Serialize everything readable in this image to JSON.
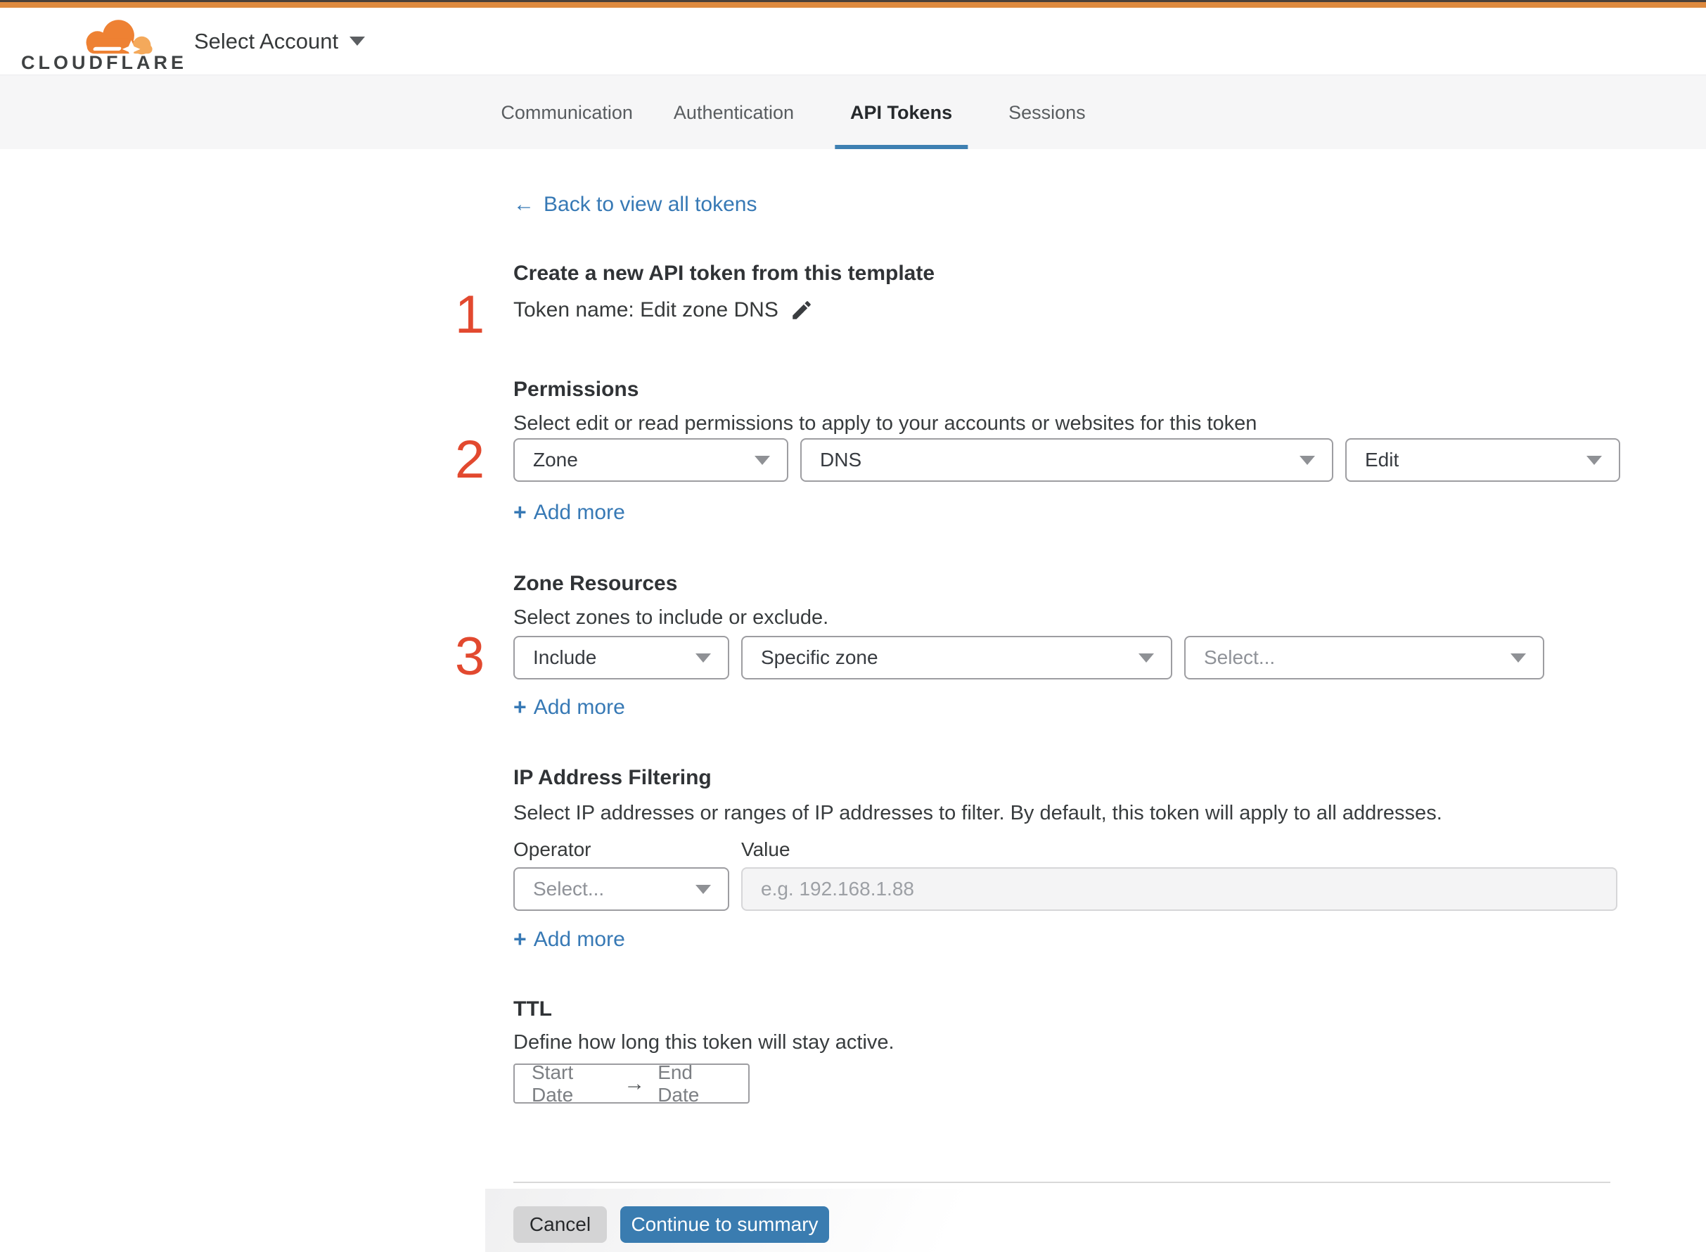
{
  "header": {
    "brand": "CLOUDFLARE",
    "account_selector_label": "Select Account"
  },
  "tabs": {
    "items": [
      {
        "label": "Communication",
        "active": false
      },
      {
        "label": "Authentication",
        "active": false
      },
      {
        "label": "API Tokens",
        "active": true
      },
      {
        "label": "Sessions",
        "active": false
      }
    ]
  },
  "back_link": {
    "arrow": "←",
    "label": "Back to view all tokens"
  },
  "step_markers": {
    "step1": "1",
    "step2": "2",
    "step3": "3"
  },
  "template_section": {
    "heading": "Create a new API token from this template",
    "token_name_line": "Token name: Edit zone DNS"
  },
  "common": {
    "add_more_plus": "+",
    "add_more_label": "Add more"
  },
  "permissions": {
    "title": "Permissions",
    "description": "Select edit or read permissions to apply to your accounts or websites for this token",
    "scope_value": "Zone",
    "resource_value": "DNS",
    "access_value": "Edit"
  },
  "zone_resources": {
    "title": "Zone Resources",
    "description": "Select zones to include or exclude.",
    "operator_value": "Include",
    "type_value": "Specific zone",
    "zone_placeholder": "Select..."
  },
  "ip_filtering": {
    "title": "IP Address Filtering",
    "description": "Select IP addresses or ranges of IP addresses to filter. By default, this token will apply to all addresses.",
    "operator_label": "Operator",
    "value_label": "Value",
    "operator_placeholder": "Select...",
    "value_placeholder": "e.g. 192.168.1.88"
  },
  "ttl": {
    "title": "TTL",
    "description": "Define how long this token will stay active.",
    "start_label": "Start Date",
    "arrow": "→",
    "end_label": "End Date"
  },
  "footer": {
    "cancel_label": "Cancel",
    "continue_label": "Continue to summary"
  },
  "colors": {
    "topbar_orange": "#de8a3f",
    "brand_orange": "#ee8133",
    "brand_orange_light": "#f4a95b",
    "link_blue": "#3779b5",
    "button_blue": "#3a7cb0",
    "tab_underline_blue": "#3e80b2",
    "step_number_red": "#e2492f"
  }
}
